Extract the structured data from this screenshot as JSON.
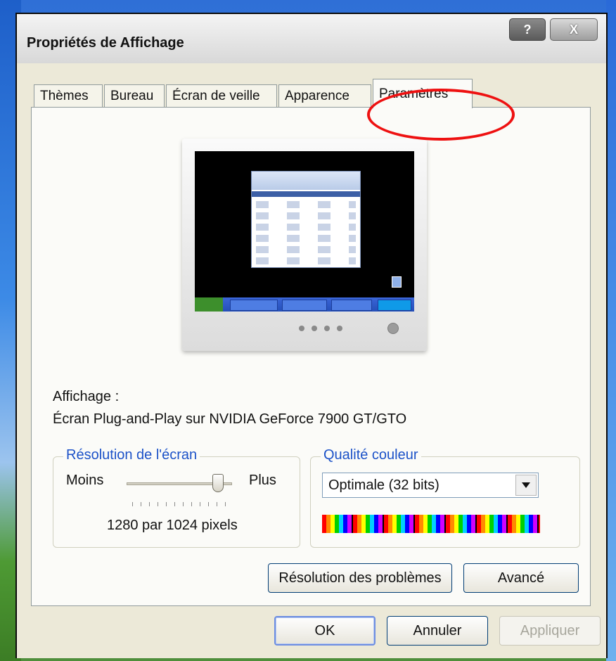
{
  "window": {
    "title": "Propriétés de Affichage",
    "help_label": "?",
    "close_label": "X"
  },
  "tabs": [
    {
      "label": "Thèmes"
    },
    {
      "label": "Bureau"
    },
    {
      "label": "Écran de veille"
    },
    {
      "label": "Apparence"
    },
    {
      "label": "Paramètres",
      "active": true
    }
  ],
  "display": {
    "label": "Affichage :",
    "device": "Écran Plug-and-Play sur NVIDIA GeForce 7900 GT/GTO"
  },
  "resolution": {
    "group_title": "Résolution de l'écran",
    "min_label": "Moins",
    "max_label": "Plus",
    "value_text": "1280 par 1024 pixels",
    "slider_fraction": 1.0
  },
  "color_quality": {
    "group_title": "Qualité couleur",
    "selected": "Optimale (32 bits)"
  },
  "buttons": {
    "troubleshoot": "Résolution des problèmes",
    "advanced": "Avancé",
    "ok": "OK",
    "cancel": "Annuler",
    "apply": "Appliquer"
  },
  "colors": {
    "title_text": "#111111",
    "group_title": "#1c52c8",
    "highlight_circle": "#e11111",
    "window_bg": "#ece9d8"
  }
}
